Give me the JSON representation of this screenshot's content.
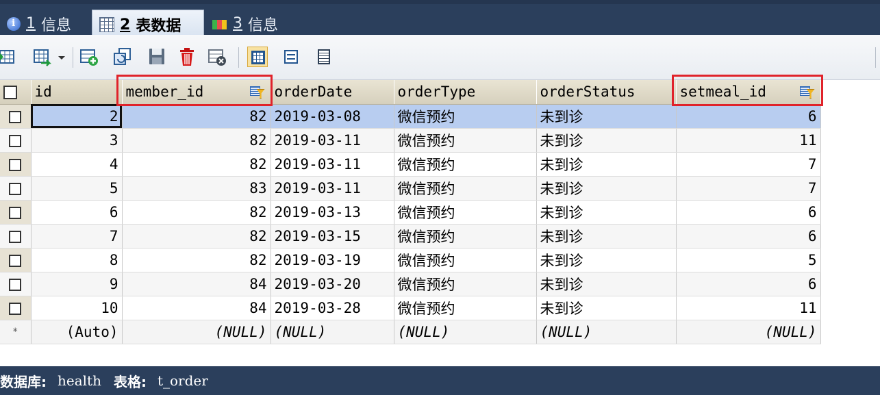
{
  "tabs": [
    {
      "num": "1",
      "label": "信息",
      "icon": "info-icon"
    },
    {
      "num": "2",
      "label": "表数据",
      "icon": "table-icon",
      "active": true
    },
    {
      "num": "3",
      "label": "信息",
      "icon": "info-icon"
    }
  ],
  "table": {
    "columns": [
      "id",
      "member_id",
      "orderDate",
      "orderType",
      "orderStatus",
      "setmeal_id"
    ],
    "rows": [
      [
        "2",
        "82",
        "2019-03-08",
        "微信预约",
        "未到诊",
        "6"
      ],
      [
        "3",
        "82",
        "2019-03-11",
        "微信预约",
        "未到诊",
        "11"
      ],
      [
        "4",
        "82",
        "2019-03-11",
        "微信预约",
        "未到诊",
        "7"
      ],
      [
        "5",
        "83",
        "2019-03-11",
        "微信预约",
        "未到诊",
        "7"
      ],
      [
        "6",
        "82",
        "2019-03-13",
        "微信预约",
        "未到诊",
        "6"
      ],
      [
        "7",
        "82",
        "2019-03-15",
        "微信预约",
        "未到诊",
        "6"
      ],
      [
        "8",
        "82",
        "2019-03-19",
        "微信预约",
        "未到诊",
        "5"
      ],
      [
        "9",
        "84",
        "2019-03-20",
        "微信预约",
        "未到诊",
        "6"
      ],
      [
        "10",
        "84",
        "2019-03-28",
        "微信预约",
        "未到诊",
        "11"
      ]
    ],
    "new_row": {
      "marker": "*",
      "values": [
        "(Auto)",
        "(NULL)",
        "(NULL)",
        "(NULL)",
        "(NULL)",
        "(NULL)"
      ]
    }
  },
  "status": {
    "database_label": "数据库:",
    "database": "health",
    "table_label": "表格:",
    "table": "t_order"
  },
  "colors": {
    "highlight": "#e0232b",
    "selected_row": "#b8cdf0",
    "chrome": "#2b3f5c"
  }
}
